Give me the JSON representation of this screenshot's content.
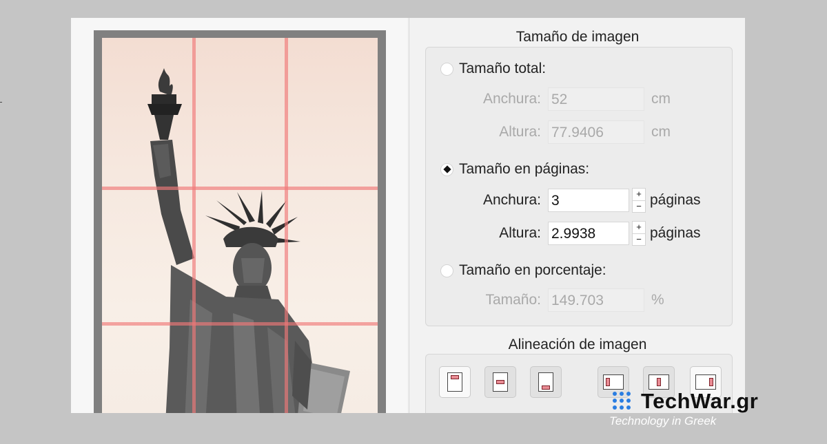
{
  "image_size": {
    "title": "Tamaño de imagen",
    "total": {
      "label": "Tamaño total:",
      "width_label": "Anchura:",
      "width_value": "52",
      "width_unit": "cm",
      "height_label": "Altura:",
      "height_value": "77.9406",
      "height_unit": "cm",
      "selected": false
    },
    "pages": {
      "label": "Tamaño en páginas:",
      "width_label": "Anchura:",
      "width_value": "3",
      "width_unit": "páginas",
      "height_label": "Altura:",
      "height_value": "2.9938",
      "height_unit": "páginas",
      "selected": true,
      "stepper_plus": "+",
      "stepper_minus": "−"
    },
    "percent": {
      "label": "Tamaño en porcentaje:",
      "size_label": "Tamaño:",
      "size_value": "149.703",
      "size_unit": "%",
      "selected": false
    }
  },
  "alignment": {
    "title": "Alineación de imagen",
    "buttons": [
      {
        "icon": "align-top-icon",
        "pressed": false
      },
      {
        "icon": "align-middle-icon",
        "pressed": true
      },
      {
        "icon": "align-bottom-icon",
        "pressed": true
      },
      {
        "icon": "align-left-icon",
        "pressed": true
      },
      {
        "icon": "align-center-icon",
        "pressed": true
      },
      {
        "icon": "align-right-icon",
        "pressed": false
      }
    ]
  },
  "preview": {
    "grid_columns": 3,
    "grid_rows": 3,
    "image": "statue-of-liberty"
  },
  "watermark": {
    "name": "TechWar.gr",
    "tagline": "Technology in Greek",
    "icon": "dot-grid-logo-icon",
    "accent": "#2a7de1"
  },
  "colors": {
    "grid_line": "#f07878",
    "page_mark": "#e98c94"
  }
}
